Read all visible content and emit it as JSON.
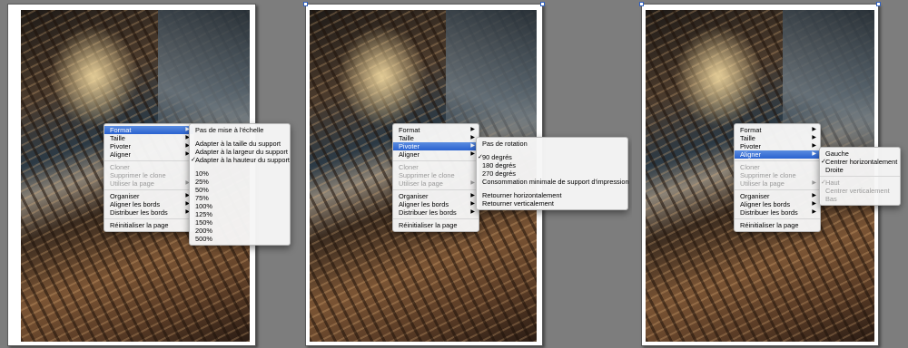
{
  "main_menu": {
    "items": [
      {
        "label": "Format",
        "arrow": "▶",
        "key": "format"
      },
      {
        "label": "Taille",
        "arrow": "▶",
        "key": "taille"
      },
      {
        "label": "Pivoter",
        "arrow": "▶",
        "key": "pivoter"
      },
      {
        "label": "Aligner",
        "arrow": "▶",
        "key": "aligner"
      },
      {
        "sep": true
      },
      {
        "label": "Cloner",
        "disabled": true,
        "key": "cloner"
      },
      {
        "label": "Supprimer le clone",
        "disabled": true,
        "key": "supprimer-clone"
      },
      {
        "label": "Utiliser la page",
        "arrow": "▶",
        "disabled": true,
        "key": "utiliser-page"
      },
      {
        "sep": true
      },
      {
        "label": "Organiser",
        "arrow": "▶",
        "key": "organiser"
      },
      {
        "label": "Aligner les bords",
        "arrow": "▶",
        "key": "aligner-bords"
      },
      {
        "label": "Distribuer les bords",
        "arrow": "▶",
        "key": "distribuer-bords"
      },
      {
        "sep": true
      },
      {
        "label": "Réinitialiser la page",
        "key": "reinitialiser-page"
      }
    ]
  },
  "panels": [
    {
      "selected": "format",
      "submenu": [
        {
          "label": "Pas de mise à l'échelle"
        },
        {
          "gap": true
        },
        {
          "label": "Adapter à la taille du support"
        },
        {
          "label": "Adapter à la largeur du support"
        },
        {
          "label": "Adapter à la hauteur du support",
          "checked": true
        },
        {
          "gap": true
        },
        {
          "label": "10%"
        },
        {
          "label": "25%"
        },
        {
          "label": "50%"
        },
        {
          "label": "75%"
        },
        {
          "label": "100%"
        },
        {
          "label": "125%"
        },
        {
          "label": "150%"
        },
        {
          "label": "200%"
        },
        {
          "label": "500%"
        }
      ]
    },
    {
      "selected": "pivoter",
      "submenu": [
        {
          "label": "Pas de rotation"
        },
        {
          "gap": true
        },
        {
          "label": "90 degrés",
          "checked": true
        },
        {
          "label": "180 degrés"
        },
        {
          "label": "270 degrés"
        },
        {
          "label": "Consommation minimale de support d'impression"
        },
        {
          "gap": true
        },
        {
          "label": "Retourner horizontalement"
        },
        {
          "label": "Retourner verticalement"
        }
      ]
    },
    {
      "selected": "aligner",
      "submenu": [
        {
          "label": "Gauche"
        },
        {
          "label": "Centrer horizontalement",
          "checked": true
        },
        {
          "label": "Droite"
        },
        {
          "sep": true
        },
        {
          "label": "Haut",
          "checked": true,
          "disabled": true
        },
        {
          "label": "Centrer verticalement",
          "disabled": true
        },
        {
          "label": "Bas",
          "disabled": true
        }
      ]
    }
  ],
  "glyphs": {
    "check": "✓"
  }
}
